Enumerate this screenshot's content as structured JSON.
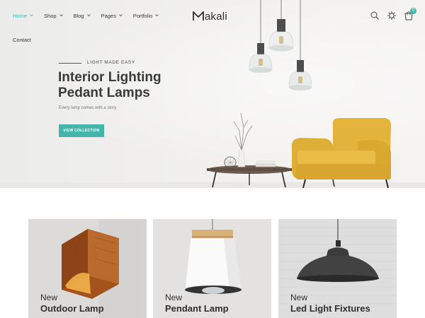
{
  "header": {
    "logo_text": "akali",
    "nav": [
      {
        "label": "Home",
        "active": true,
        "has_dropdown": true
      },
      {
        "label": "Shop",
        "active": false,
        "has_dropdown": true
      },
      {
        "label": "Blog",
        "active": false,
        "has_dropdown": true
      },
      {
        "label": "Pages",
        "active": false,
        "has_dropdown": true
      },
      {
        "label": "Portfolio",
        "active": false,
        "has_dropdown": true
      },
      {
        "label": "Contact",
        "active": false,
        "has_dropdown": false
      }
    ],
    "icons": [
      "search-icon",
      "settings-icon",
      "cart-icon"
    ],
    "cart_count": "0"
  },
  "hero": {
    "eyebrow": "LIGHT MADE EASY",
    "title_line1": "Interior Lighting",
    "title_line2": "Pedant Lamps",
    "subtitle": "Every lamp comes with a story",
    "button_label": "VIEW COLLECTION"
  },
  "categories": [
    {
      "tag": "New",
      "title": "Outdoor Lamp"
    },
    {
      "tag": "New",
      "title": "Pendant Lamp"
    },
    {
      "tag": "New",
      "title": "Led Light Fixtures"
    }
  ],
  "colors": {
    "accent": "#45b5ab",
    "text_dark": "#3a3a3a",
    "chair": "#e0b33c",
    "card_bg": "#dfdfdf"
  }
}
